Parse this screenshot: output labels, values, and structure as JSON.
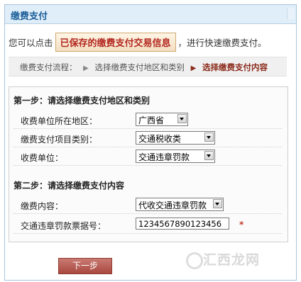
{
  "header": {
    "title": "缴费支付"
  },
  "intro": {
    "prefix": "您可以点击",
    "saved_button": "已保存的缴费支付交易信息",
    "suffix": "，进行快速缴费支付。"
  },
  "steps": {
    "label": "缴费支付流程：",
    "step1": "选择缴费支付地区和类别",
    "step2": "选择缴费支付内容",
    "separator": "▶"
  },
  "section1": {
    "title": "第一步：请选择缴费支付地区和类别",
    "rows": [
      {
        "label": "收费单位所在地区：",
        "value": "广西省"
      },
      {
        "label": "缴费支付项目类别：",
        "value": "交通税收类"
      },
      {
        "label": "收费单位：",
        "value": "交通违章罚款"
      }
    ]
  },
  "section2": {
    "title": "第二步：请选择缴费支付内容",
    "rows": [
      {
        "label": "缴费内容：",
        "value": "代收交通违章罚款"
      },
      {
        "label": "交通违章罚款票据号：",
        "value": "1234567890123456",
        "required_mark": "*"
      }
    ]
  },
  "next_button": "下一步",
  "watermark": "汇西龙网"
}
